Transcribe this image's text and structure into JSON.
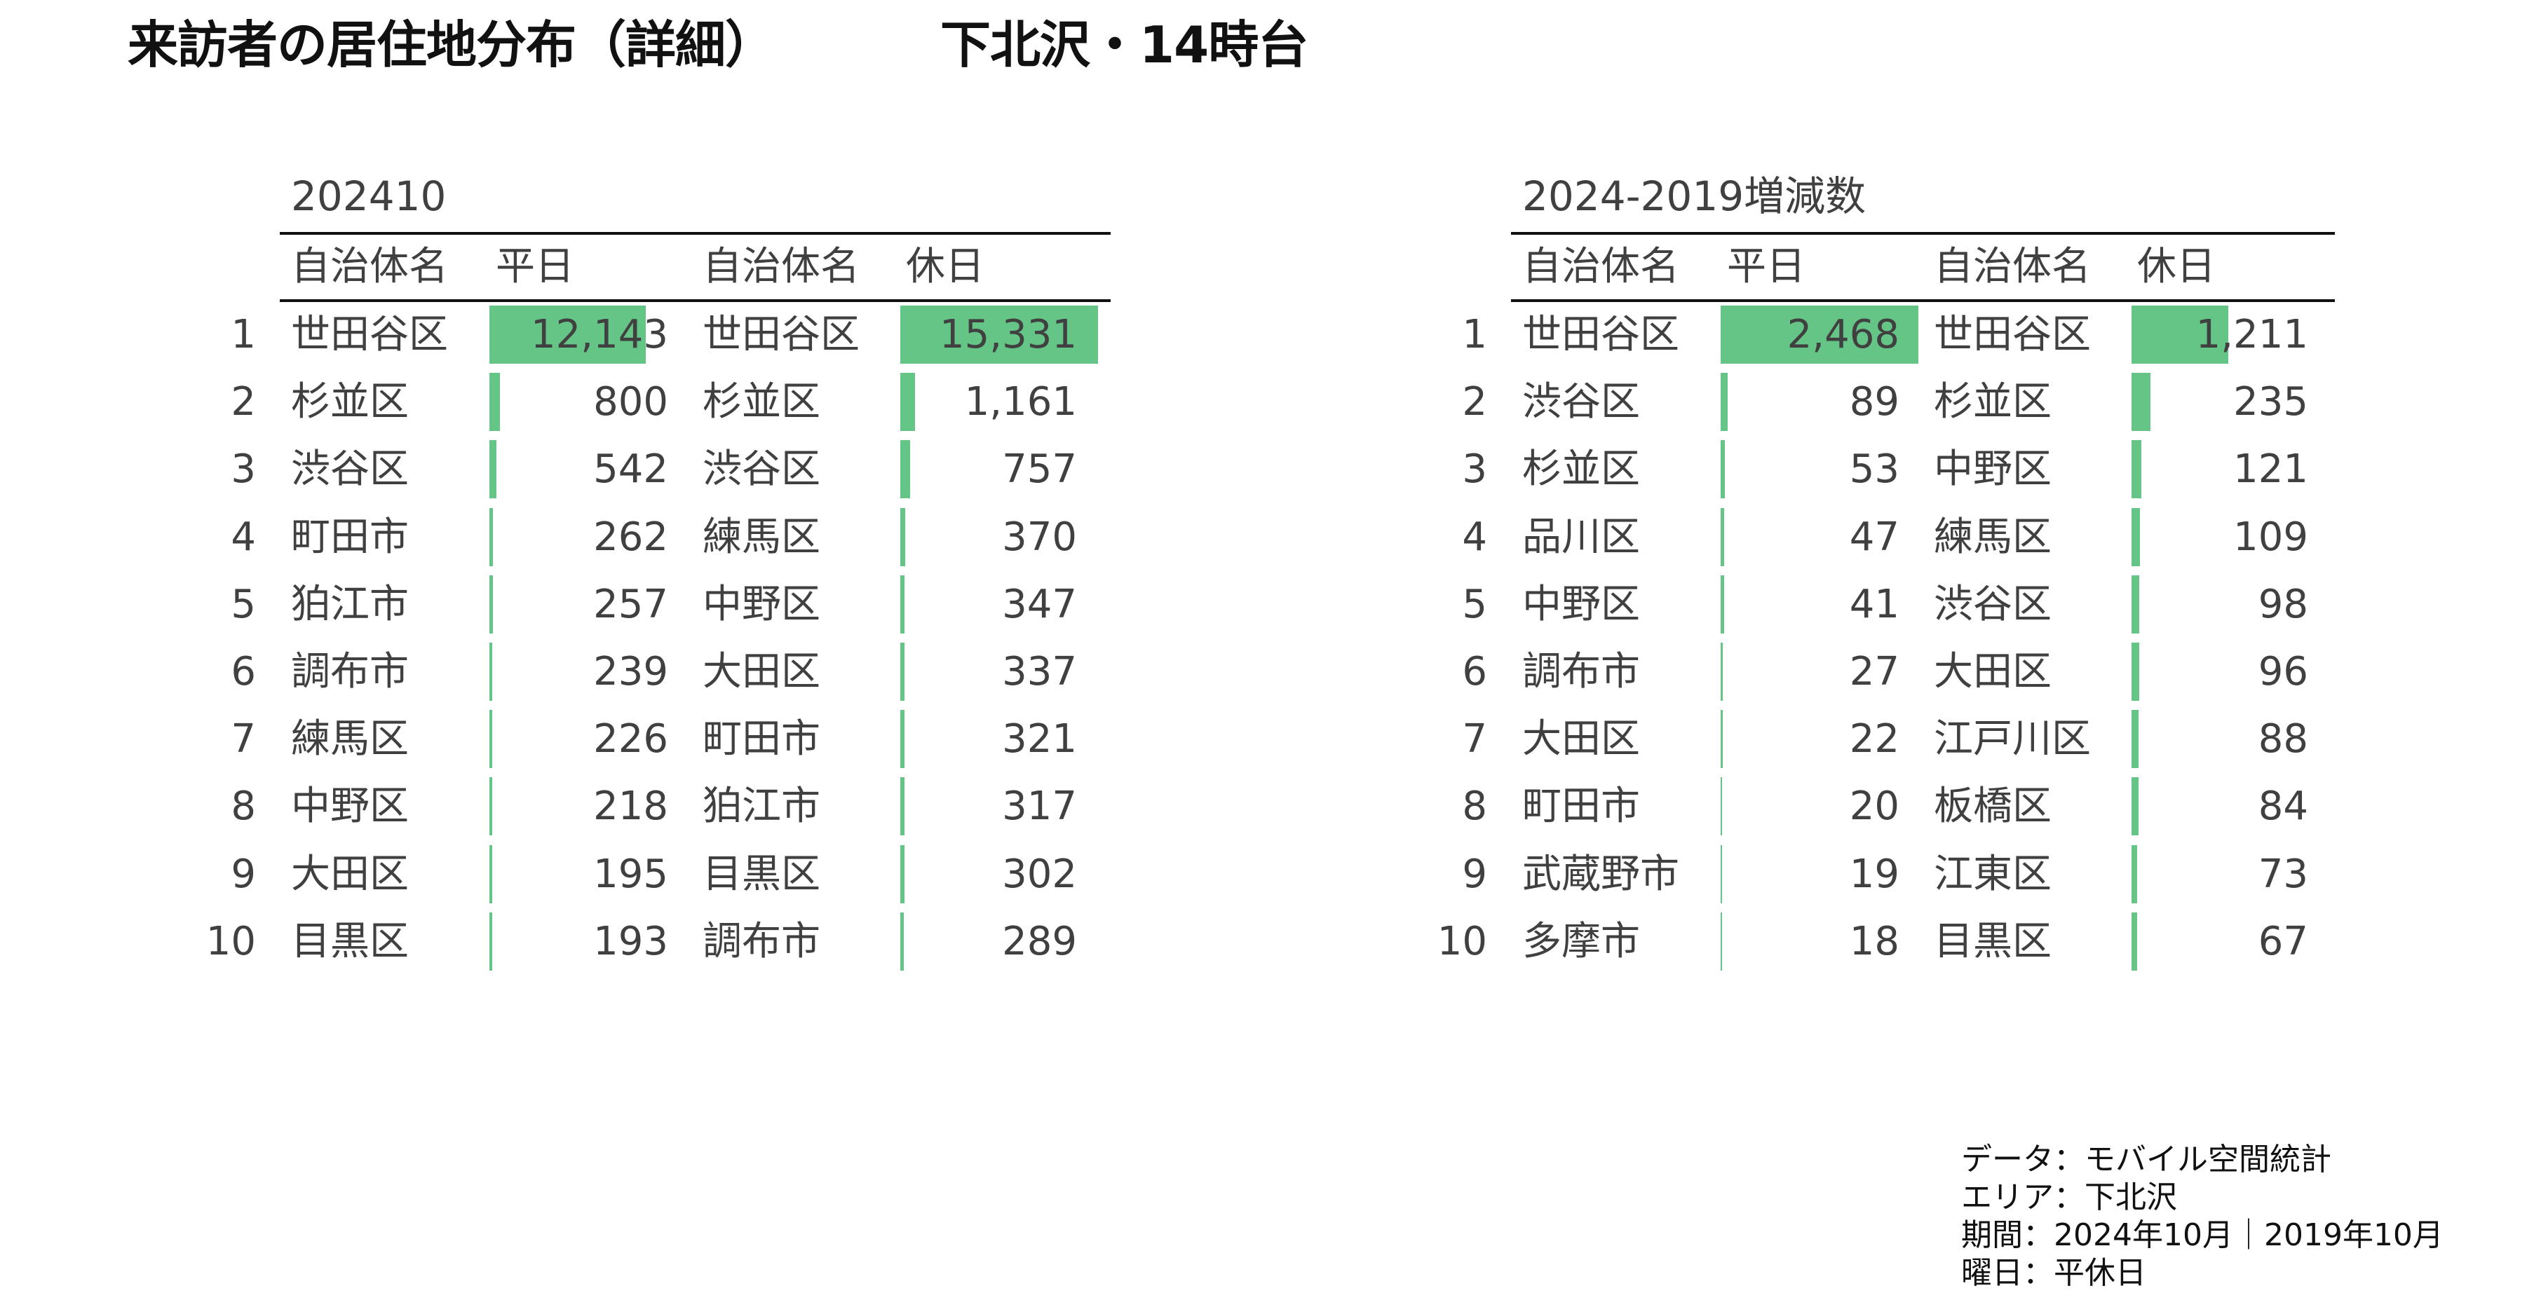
{
  "title": {
    "main": "来訪者の居住地分布（詳細）",
    "sub": "下北沢・14時台"
  },
  "colors": {
    "bar": "#64C587",
    "text": "#404040",
    "title": "#111111"
  },
  "chart_data": [
    {
      "type": "table",
      "title": "202410",
      "columns": [
        "自治体名",
        "平日",
        "自治体名",
        "休日"
      ],
      "ranks": [
        1,
        2,
        3,
        4,
        5,
        6,
        7,
        8,
        9,
        10
      ],
      "weekday": {
        "names": [
          "世田谷区",
          "杉並区",
          "渋谷区",
          "町田市",
          "狛江市",
          "調布市",
          "練馬区",
          "中野区",
          "大田区",
          "目黒区"
        ],
        "values": [
          12143,
          800,
          542,
          262,
          257,
          239,
          226,
          218,
          195,
          193
        ],
        "labels": [
          "12,143",
          "800",
          "542",
          "262",
          "257",
          "239",
          "226",
          "218",
          "195",
          "193"
        ]
      },
      "holiday": {
        "names": [
          "世田谷区",
          "杉並区",
          "渋谷区",
          "練馬区",
          "中野区",
          "大田区",
          "町田市",
          "狛江市",
          "目黒区",
          "調布市"
        ],
        "values": [
          15331,
          1161,
          757,
          370,
          347,
          337,
          321,
          317,
          302,
          289
        ],
        "labels": [
          "15,331",
          "1,161",
          "757",
          "370",
          "347",
          "337",
          "321",
          "317",
          "302",
          "289"
        ]
      },
      "bar_scale_max": 15331
    },
    {
      "type": "table",
      "title": "2024-2019増減数",
      "columns": [
        "自治体名",
        "平日",
        "自治体名",
        "休日"
      ],
      "ranks": [
        1,
        2,
        3,
        4,
        5,
        6,
        7,
        8,
        9,
        10
      ],
      "weekday": {
        "names": [
          "世田谷区",
          "渋谷区",
          "杉並区",
          "品川区",
          "中野区",
          "調布市",
          "大田区",
          "町田市",
          "武蔵野市",
          "多摩市"
        ],
        "values": [
          2468,
          89,
          53,
          47,
          41,
          27,
          22,
          20,
          19,
          18
        ],
        "labels": [
          "2,468",
          "89",
          "53",
          "47",
          "41",
          "27",
          "22",
          "20",
          "19",
          "18"
        ]
      },
      "holiday": {
        "names": [
          "世田谷区",
          "杉並区",
          "中野区",
          "練馬区",
          "渋谷区",
          "大田区",
          "江戸川区",
          "板橋区",
          "江東区",
          "目黒区"
        ],
        "values": [
          1211,
          235,
          121,
          109,
          98,
          96,
          88,
          84,
          73,
          67
        ],
        "labels": [
          "1,211",
          "235",
          "121",
          "109",
          "98",
          "96",
          "88",
          "84",
          "73",
          "67"
        ]
      },
      "bar_scale_max": 2468
    }
  ],
  "footer": {
    "lines": [
      "データ：モバイル空間統計",
      "エリア：下北沢",
      "期間：2024年10月｜2019年10月",
      "曜日：平休日"
    ]
  }
}
